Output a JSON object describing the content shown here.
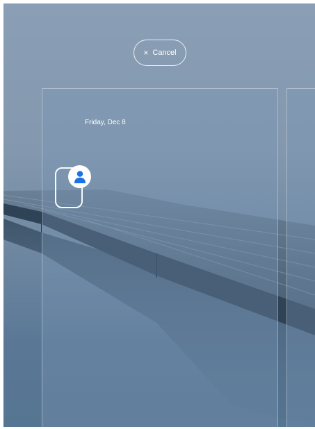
{
  "lock_screen": {
    "cancel_label": "Cancel",
    "cancel_icon": "close-icon",
    "date": "Friday, Dec 8",
    "avatar_icon": "person-icon"
  },
  "colors": {
    "sky": "#8a9fb5",
    "water": "#567592",
    "dock": "#4f6478",
    "avatar_blue": "#1a73e8"
  }
}
